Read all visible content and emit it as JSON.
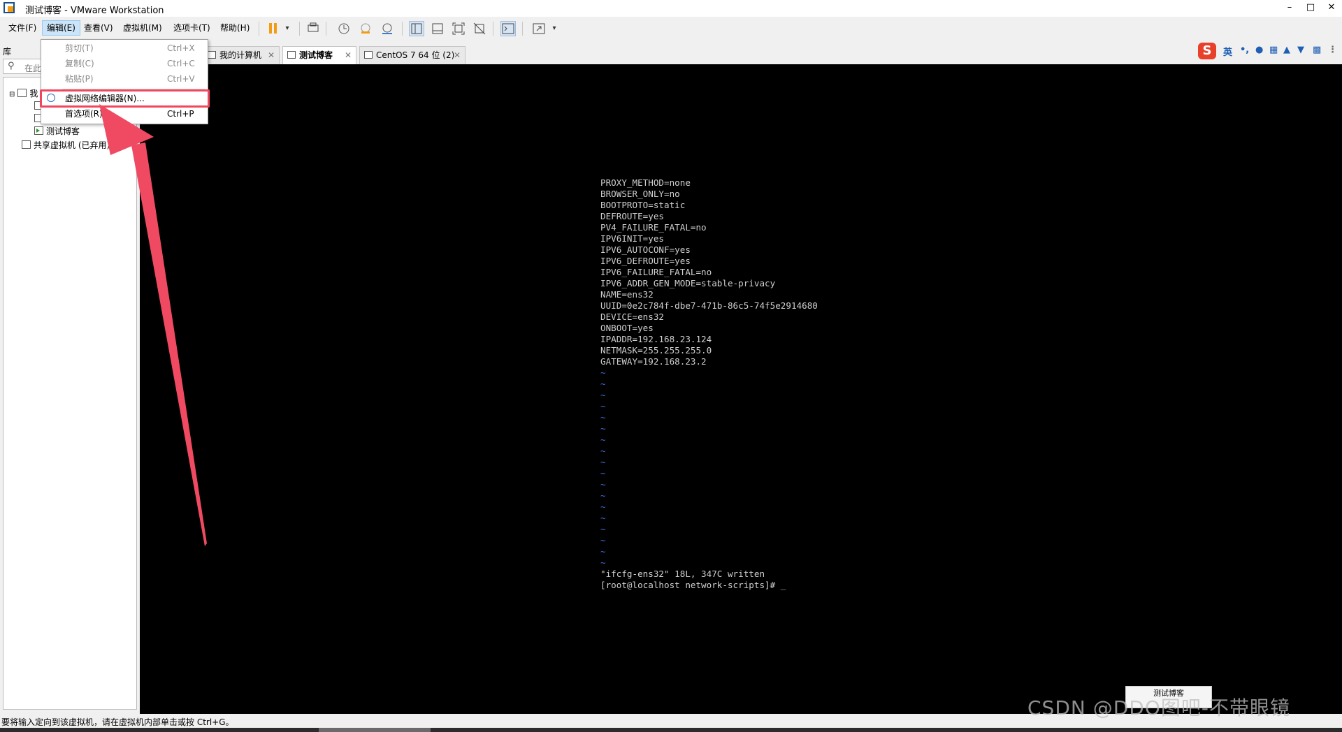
{
  "window": {
    "title": "测试博客 - VMware Workstation",
    "controls": [
      "–",
      "□",
      "✕"
    ]
  },
  "menubar": {
    "items": [
      "文件(F)",
      "编辑(E)",
      "查看(V)",
      "虚拟机(M)",
      "选项卡(T)",
      "帮助(H)"
    ],
    "active_index": 1
  },
  "toolbar": {
    "icons": [
      "pause-icon",
      "dropdown-arrow-icon",
      "send-keys-icon",
      "snapshot-icon",
      "revert-snapshot-icon",
      "snapshot-manager-icon",
      "library-view-icon",
      "thumbnail-view-icon",
      "fullscreen-icon",
      "unity-icon",
      "console-icon",
      "stretch-icon"
    ]
  },
  "library": {
    "title": "库",
    "search_placeholder": "在此",
    "tree": [
      {
        "label": "我",
        "icon": "computer-icon"
      },
      {
        "label": "",
        "icon": "vm-icon"
      },
      {
        "label": "",
        "icon": "vm-icon"
      },
      {
        "label": "测试博客",
        "icon": "vm-running-icon"
      },
      {
        "label": "共享虚拟机 (已弃用)",
        "icon": "shared-vm-icon"
      }
    ]
  },
  "edit_menu": {
    "items": [
      {
        "label": "剪切(T)",
        "shortcut": "Ctrl+X",
        "enabled": false
      },
      {
        "label": "复制(C)",
        "shortcut": "Ctrl+C",
        "enabled": false
      },
      {
        "label": "粘贴(P)",
        "shortcut": "Ctrl+V",
        "enabled": false
      },
      {
        "label": "虚拟网络编辑器(N)...",
        "shortcut": "",
        "enabled": true
      },
      {
        "label": "首选项(R)...",
        "shortcut": "Ctrl+P",
        "enabled": true
      }
    ],
    "highlighted_index": 3
  },
  "tabs": [
    {
      "label": "我的计算机",
      "active": false
    },
    {
      "label": "测试博客",
      "active": true
    },
    {
      "label": "CentOS 7 64 位 (2)",
      "active": false
    }
  ],
  "ime": {
    "logo": "S",
    "mode": "英"
  },
  "console": {
    "lines": [
      "PROXY_METHOD=none",
      "BROWSER_ONLY=no",
      "BOOTPROTO=static",
      "DEFROUTE=yes",
      "PV4_FAILURE_FATAL=no",
      "IPV6INIT=yes",
      "IPV6_AUTOCONF=yes",
      "IPV6_DEFROUTE=yes",
      "IPV6_FAILURE_FATAL=no",
      "IPV6_ADDR_GEN_MODE=stable-privacy",
      "NAME=ens32",
      "UUID=0e2c784f-dbe7-471b-86c5-74f5e2914680",
      "DEVICE=ens32",
      "ONBOOT=yes",
      "IPADDR=192.168.23.124",
      "NETMASK=255.255.255.0",
      "GATEWAY=192.168.23.2"
    ],
    "tilde_count": 18,
    "written_msg": "\"ifcfg-ens32\" 18L, 347C written",
    "prompt": "[root@localhost network-scripts]# _",
    "vm_label": "测试博客"
  },
  "status": {
    "text": "要将输入定向到该虚拟机，请在虚拟机内部单击或按 Ctrl+G。"
  },
  "watermark": "CSDN @DDO图吧-不带眼镜",
  "colors": {
    "highlight": "#f0475f",
    "console_bg": "#000000",
    "console_text": "#cfcfcf",
    "tilde": "#3f6fd8",
    "pause": "#f39c12"
  }
}
